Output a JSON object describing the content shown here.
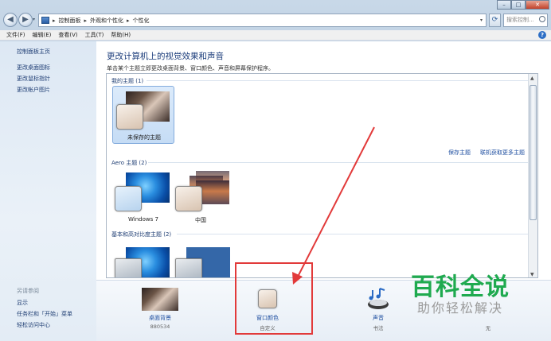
{
  "nav": {
    "breadcrumbs": [
      "控制面板",
      "外观和个性化",
      "个性化"
    ],
    "search_placeholder": "搜索控制..."
  },
  "menu": [
    "文件(F)",
    "编辑(E)",
    "查看(V)",
    "工具(T)",
    "帮助(H)"
  ],
  "sidebar": {
    "links": [
      "控制面板主页",
      "更改桌面图标",
      "更改鼠标指针",
      "更改帐户图片"
    ],
    "see_also_title": "另请参阅",
    "see_also": [
      "显示",
      "任务栏和「开始」菜单",
      "轻松访问中心"
    ]
  },
  "main": {
    "heading": "更改计算机上的视觉效果和声音",
    "description": "单击某个主题立即更改桌面背景、窗口颜色、声音和屏幕保护程序。",
    "my_themes": {
      "title": "我的主题 (1)",
      "unsaved": "未保存的主题",
      "save_link": "保存主题",
      "online_link": "联机获取更多主题"
    },
    "aero": {
      "title": "Aero 主题 (2)",
      "items": [
        "Windows 7",
        "中国"
      ]
    },
    "basic": {
      "title": "基本和高对比度主题 (2)"
    }
  },
  "bottom": {
    "items": [
      {
        "label": "桌面背景",
        "sub": "880534"
      },
      {
        "label": "窗口颜色",
        "sub": "自定义"
      },
      {
        "label": "声音",
        "sub": "书法"
      },
      {
        "label": "屏幕保护程序",
        "sub": "无"
      }
    ]
  },
  "watermark": {
    "title": "百科全说",
    "subtitle": "助你轻松解决"
  },
  "colors": {
    "highlight": "#e23a3a",
    "watermark": "#1faa4f"
  }
}
